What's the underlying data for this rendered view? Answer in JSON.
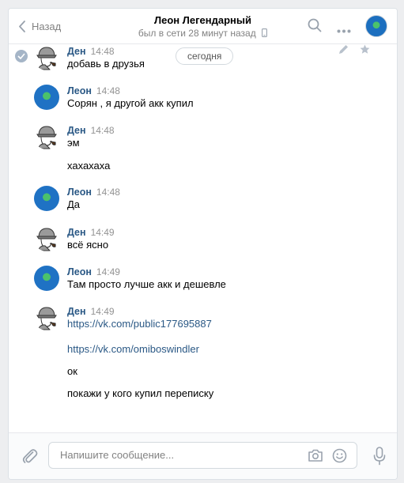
{
  "header": {
    "back_label": "Назад",
    "title": "Леон Легендарный",
    "status": "был в сети 28 минут назад"
  },
  "date_separator": "сегодня",
  "messages": [
    {
      "author": "Ден",
      "time": "14:48",
      "avatar": "den",
      "lines": [
        "добавь в друзья"
      ]
    },
    {
      "author": "Леон",
      "time": "14:48",
      "avatar": "leon",
      "lines": [
        "Сорян , я другой акк купил"
      ]
    },
    {
      "author": "Ден",
      "time": "14:48",
      "avatar": "den",
      "lines": [
        "эм",
        "хахахаха"
      ]
    },
    {
      "author": "Леон",
      "time": "14:48",
      "avatar": "leon",
      "lines": [
        "Да"
      ]
    },
    {
      "author": "Ден",
      "time": "14:49",
      "avatar": "den",
      "lines": [
        "всё ясно"
      ]
    },
    {
      "author": "Леон",
      "time": "14:49",
      "avatar": "leon",
      "lines": [
        "Там просто лучше акк и дешевле"
      ]
    },
    {
      "author": "Ден",
      "time": "14:49",
      "avatar": "den",
      "lines": [
        "https://vk.com/public177695887",
        "https://vk.com/omiboswindler",
        "ок",
        "покажи у кого купил переписку"
      ]
    }
  ],
  "composer": {
    "placeholder": "Напишите сообщение..."
  },
  "colors": {
    "link": "#2a5885",
    "author": "#2a5885",
    "muted": "#828282",
    "background": "#edeef0"
  }
}
